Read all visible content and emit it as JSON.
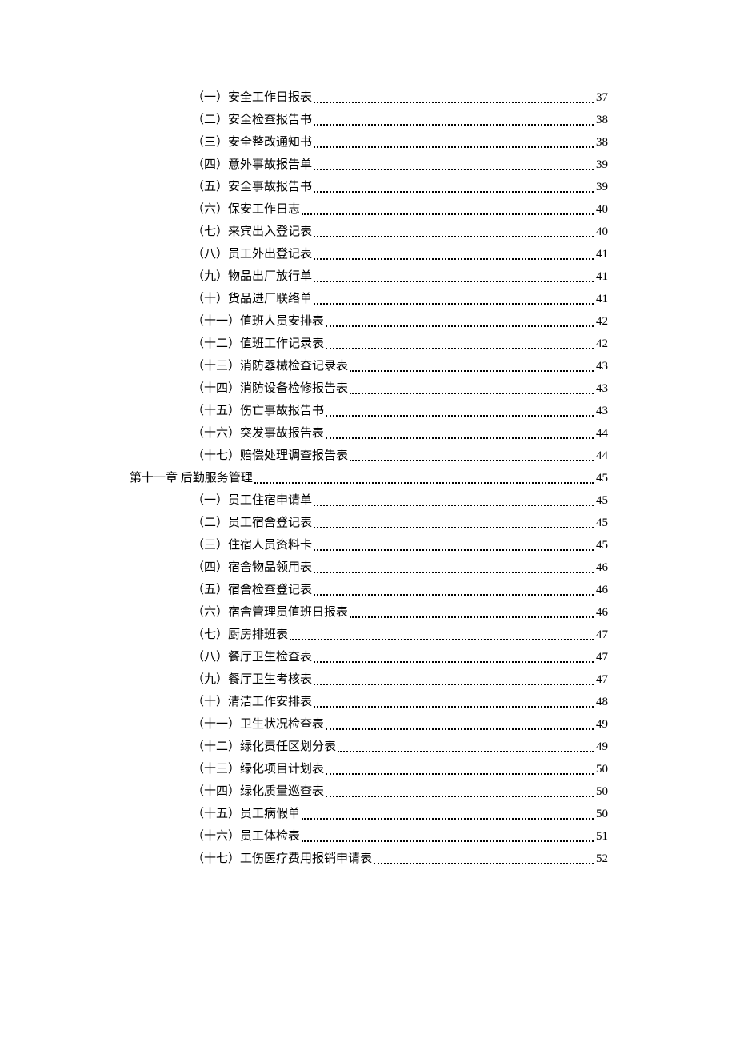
{
  "toc": [
    {
      "level": 2,
      "label": "（一）安全工作日报表",
      "page": "37"
    },
    {
      "level": 2,
      "label": "（二）安全检查报告书",
      "page": "38"
    },
    {
      "level": 2,
      "label": "（三）安全整改通知书",
      "page": "38"
    },
    {
      "level": 2,
      "label": "（四）意外事故报告单",
      "page": "39"
    },
    {
      "level": 2,
      "label": "（五）安全事故报告书",
      "page": "39"
    },
    {
      "level": 2,
      "label": "（六）保安工作日志",
      "page": "40"
    },
    {
      "level": 2,
      "label": "（七）来宾出入登记表",
      "page": "40"
    },
    {
      "level": 2,
      "label": "（八）员工外出登记表",
      "page": "41"
    },
    {
      "level": 2,
      "label": "（九）物品出厂放行单",
      "page": "41"
    },
    {
      "level": 2,
      "label": "（十）货品进厂联络单",
      "page": "41"
    },
    {
      "level": 2,
      "label": "（十一）值班人员安排表",
      "page": "42"
    },
    {
      "level": 2,
      "label": "（十二）值班工作记录表",
      "page": "42"
    },
    {
      "level": 2,
      "label": "（十三）消防器械检查记录表",
      "page": "43"
    },
    {
      "level": 2,
      "label": "（十四）消防设备检修报告表",
      "page": "43"
    },
    {
      "level": 2,
      "label": "（十五）伤亡事故报告书",
      "page": "43"
    },
    {
      "level": 2,
      "label": "（十六）突发事故报告表",
      "page": "44"
    },
    {
      "level": 2,
      "label": "（十七）赔偿处理调查报告表",
      "page": "44"
    },
    {
      "level": 1,
      "label": "第十一章 后勤服务管理",
      "page": "45"
    },
    {
      "level": 2,
      "label": "（一）员工住宿申请单",
      "page": "45"
    },
    {
      "level": 2,
      "label": "（二）员工宿舍登记表",
      "page": "45"
    },
    {
      "level": 2,
      "label": "（三）住宿人员资料卡",
      "page": "45"
    },
    {
      "level": 2,
      "label": "（四）宿舍物品领用表",
      "page": "46"
    },
    {
      "level": 2,
      "label": "（五）宿舍检查登记表",
      "page": "46"
    },
    {
      "level": 2,
      "label": "（六）宿舍管理员值班日报表",
      "page": "46"
    },
    {
      "level": 2,
      "label": "（七）厨房排班表",
      "page": "47"
    },
    {
      "level": 2,
      "label": "（八）餐厅卫生检查表",
      "page": "47"
    },
    {
      "level": 2,
      "label": "（九）餐厅卫生考核表",
      "page": "47"
    },
    {
      "level": 2,
      "label": "（十）清洁工作安排表",
      "page": "48"
    },
    {
      "level": 2,
      "label": "（十一）卫生状况检查表",
      "page": "49"
    },
    {
      "level": 2,
      "label": "（十二）绿化责任区划分表",
      "page": "49"
    },
    {
      "level": 2,
      "label": "（十三）绿化项目计划表",
      "page": "50"
    },
    {
      "level": 2,
      "label": "（十四）绿化质量巡查表",
      "page": "50"
    },
    {
      "level": 2,
      "label": "（十五）员工病假单",
      "page": "50"
    },
    {
      "level": 2,
      "label": "（十六）员工体检表",
      "page": "51"
    },
    {
      "level": 2,
      "label": "（十七）工伤医疗费用报销申请表",
      "page": "52"
    }
  ]
}
